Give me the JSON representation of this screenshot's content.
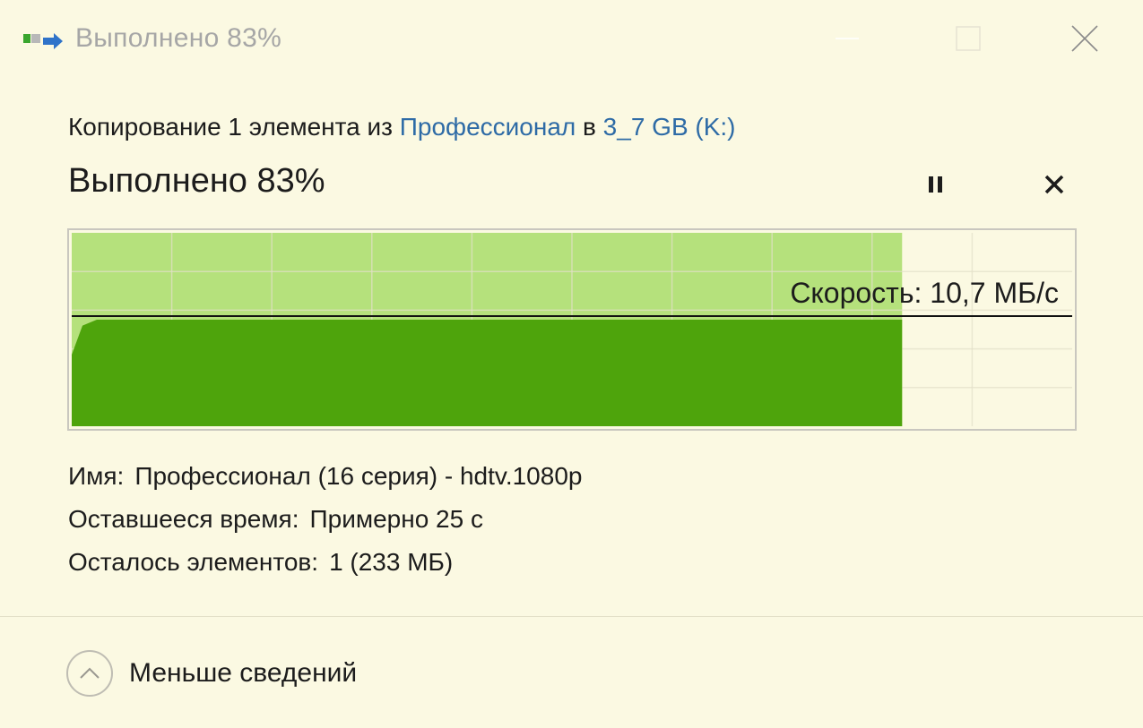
{
  "window": {
    "title": "Выполнено 83%",
    "icons": {
      "app": "copy-arrow-icon",
      "minimize": "minimize-icon",
      "maximize": "maximize-icon",
      "close": "close-icon"
    }
  },
  "copy": {
    "prefix": "Копирование 1 элемента из ",
    "source": "Профессионал",
    "middle": " в ",
    "destination": "3_7 GB (K:)"
  },
  "progress": {
    "heading": "Выполнено 83%",
    "percent": 83,
    "pause_icon": "pause-icon",
    "cancel_icon": "cancel-icon"
  },
  "speed": {
    "label": "Скорость: 10,7 МБ/с",
    "value_mb_s": 10.7
  },
  "details": {
    "name_key": "Имя:",
    "name_value": "Профессионал (16 серия) - hdtv.1080p",
    "time_key": "Оставшееся время:",
    "time_value": "Примерно 25 с",
    "items_key": "Осталось элементов:",
    "items_value": "1 (233 МБ)"
  },
  "toggle": {
    "label": "Меньше сведений",
    "icon": "chevron-up-icon"
  },
  "colors": {
    "background": "#fbf9e2",
    "progress_fill": "#b5e17c",
    "speed_fill": "#4ea40c",
    "link": "#2e6ba6",
    "title_inactive": "#a6a6a6"
  }
}
